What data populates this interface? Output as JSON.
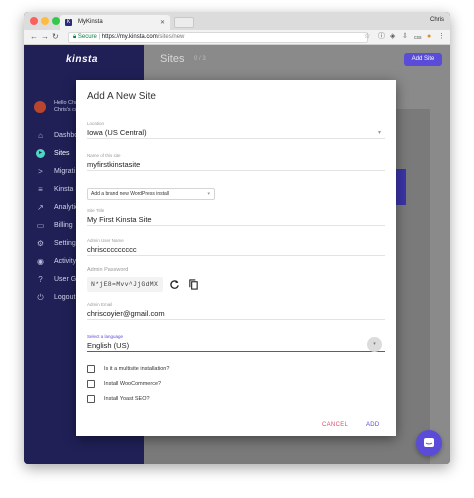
{
  "browser": {
    "tab_title": "MyKinsta",
    "tab_favicon_letter": "K",
    "profile_name": "Chris",
    "url_secure_label": "Secure",
    "url_separator": "|",
    "url_host": "https://my.kinsta.com",
    "url_path": "/sites/new",
    "colors": {
      "secure": "#0b8043",
      "close": "#fc605b",
      "minimize": "#fdbc40",
      "zoom": "#34c84a"
    }
  },
  "sidebar": {
    "logo": "kinsta",
    "greeting": "Hello Chri",
    "account": "Chris's co",
    "items": [
      {
        "label": "Dashbo",
        "icon": "home-icon"
      },
      {
        "label": "Sites",
        "icon": "sites-icon",
        "active": true
      },
      {
        "label": "Migrati",
        "icon": "migration-icon"
      },
      {
        "label": "Kinsta D",
        "icon": "dns-icon"
      },
      {
        "label": "Analytic",
        "icon": "analytics-icon"
      },
      {
        "label": "Billing",
        "icon": "billing-icon"
      },
      {
        "label": "Setting",
        "icon": "settings-icon"
      },
      {
        "label": "Activity",
        "icon": "activity-icon"
      },
      {
        "label": "User G",
        "icon": "user-guide-icon"
      },
      {
        "label": "Logout",
        "icon": "logout-icon"
      }
    ],
    "colors": {
      "background": "#202057",
      "active_icon": "#4ed6c5"
    }
  },
  "main": {
    "title": "Sites",
    "count": "0 / 3",
    "add_site_label": "Add Site",
    "accent": "#5a4cd8"
  },
  "modal": {
    "title": "Add A New Site",
    "location": {
      "label": "Location",
      "value": "Iowa (US Central)"
    },
    "site_name": {
      "label": "Name of this site",
      "value": "myfirstkinstasite"
    },
    "install_option": "Add a brand new WordPress install",
    "site_title": {
      "label": "Site Title",
      "value": "My First Kinsta Site"
    },
    "admin_username": {
      "label": "Admin User Name",
      "value": "chrisccccccccc"
    },
    "admin_password": {
      "label": "Admin Password",
      "value": "N*jE8=Mvv^JjGdMX"
    },
    "admin_email": {
      "label": "Admin Email",
      "value": "chriscoyier@gmail.com"
    },
    "language": {
      "label": "Select a language",
      "value": "English (US)"
    },
    "checkboxes": [
      {
        "label": "Is it a multisite installation?",
        "checked": false
      },
      {
        "label": "Install WooCommerce?",
        "checked": false
      },
      {
        "label": "Install Yoast SEO?",
        "checked": false
      }
    ],
    "cancel_label": "CANCEL",
    "add_label": "ADD",
    "colors": {
      "cancel": "#e04e6e",
      "add": "#5a4cd8"
    }
  }
}
